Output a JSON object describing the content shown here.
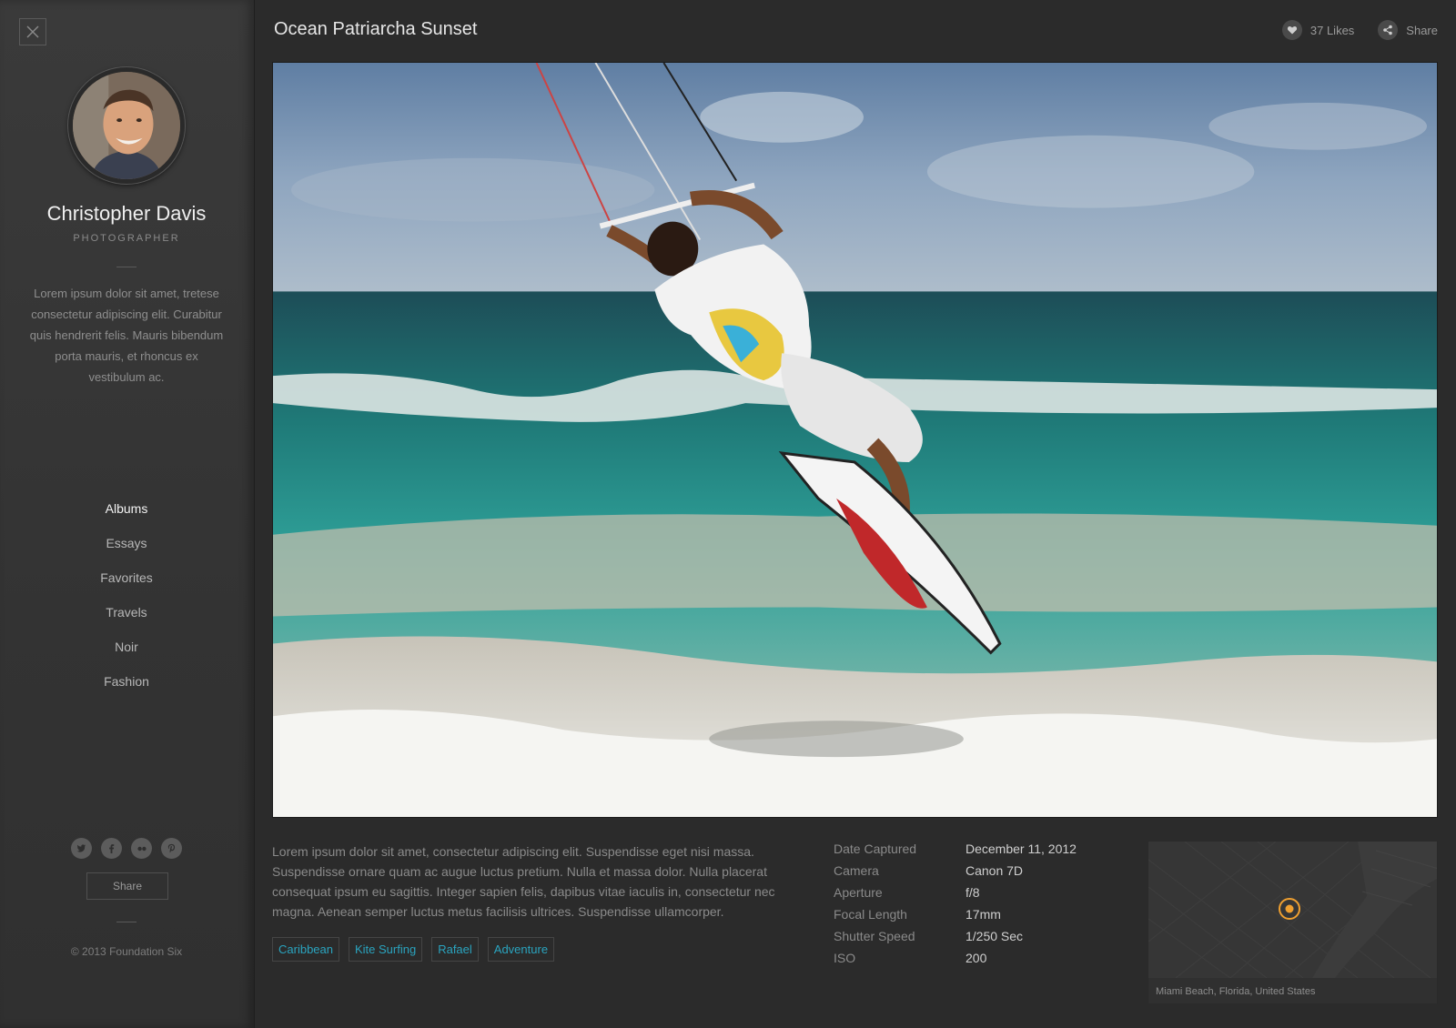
{
  "sidebar": {
    "close_icon": "close-icon",
    "profile": {
      "name": "Christopher Davis",
      "role": "PHOTOGRAPHER",
      "bio": "Lorem ipsum dolor sit amet, tretese consectetur adipiscing elit. Curabitur quis hendrerit felis. Mauris bibendum porta mauris, et rhoncus ex vestibulum ac."
    },
    "nav": [
      "Albums",
      "Essays",
      "Favorites",
      "Travels",
      "Noir",
      "Fashion"
    ],
    "active_nav": "Albums",
    "socials": [
      "twitter-icon",
      "facebook-icon",
      "flickr-icon",
      "pinterest-icon"
    ],
    "share_label": "Share",
    "copyright": "© 2013 Foundation Six"
  },
  "header": {
    "title": "Ocean Patriarcha Sunset",
    "likes_label": "37 Likes",
    "share_label": "Share"
  },
  "photo": {
    "subject": "kite surfer jumping over turquoise ocean waves"
  },
  "details": {
    "description": "Lorem ipsum dolor sit amet, consectetur adipiscing elit. Suspendisse eget nisi massa. Suspendisse ornare quam ac augue luctus pretium. Nulla et massa dolor. Nulla placerat consequat ipsum eu sagittis. Integer sapien felis, dapibus vitae iaculis in, consectetur nec magna. Aenean semper luctus metus facilisis ultrices. Suspendisse ullamcorper.",
    "tags": [
      "Caribbean",
      "Kite Surfing",
      "Rafael",
      "Adventure"
    ],
    "meta": [
      {
        "label": "Date Captured",
        "value": "December 11, 2012"
      },
      {
        "label": "Camera",
        "value": "Canon 7D"
      },
      {
        "label": "Aperture",
        "value": "f/8"
      },
      {
        "label": "Focal Length",
        "value": "17mm"
      },
      {
        "label": "Shutter Speed",
        "value": "1/250 Sec"
      },
      {
        "label": "ISO",
        "value": "200"
      }
    ],
    "map": {
      "caption": "Miami Beach, Florida, United States",
      "pin_color": "#f0a030"
    }
  },
  "colors": {
    "accent_tag": "#2aa4bf",
    "background": "#2b2b2b",
    "sidebar": "#363636"
  }
}
